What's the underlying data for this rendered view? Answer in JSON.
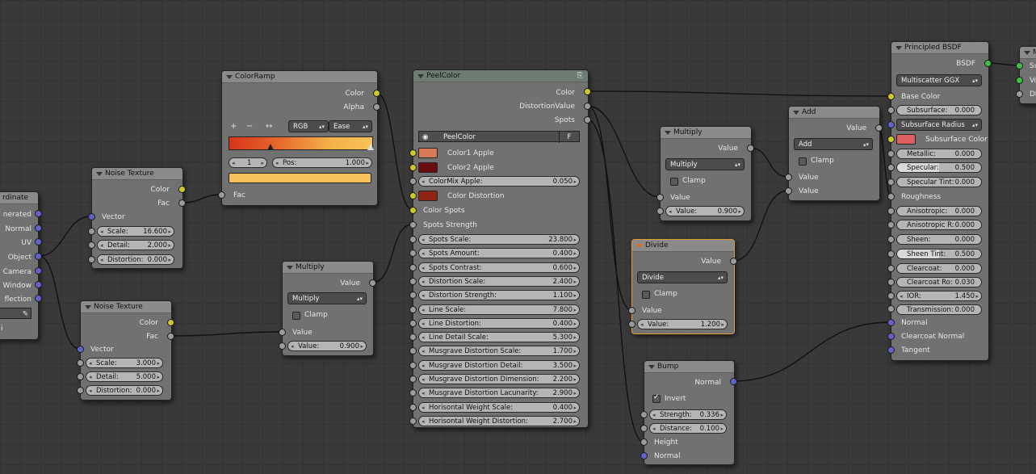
{
  "nodes": {
    "texcoord": {
      "title_partial": "rdinate",
      "outputs": [
        "nerated",
        "Normal",
        "UV",
        "Object",
        "Camera",
        "Window",
        "flection"
      ],
      "field_partial": "i"
    },
    "noise1": {
      "title": "Noise Texture",
      "outputs": [
        "Color",
        "Fac"
      ],
      "input_vector": "Vector",
      "fields": [
        {
          "label": "Scale:",
          "value": "16.600"
        },
        {
          "label": "Detail:",
          "value": "2.000"
        },
        {
          "label": "Distortion:",
          "value": "0.000"
        }
      ]
    },
    "noise2": {
      "title": "Noise Texture",
      "outputs": [
        "Color",
        "Fac"
      ],
      "input_vector": "Vector",
      "fields": [
        {
          "label": "Scale:",
          "value": "3.000"
        },
        {
          "label": "Detail:",
          "value": "5.000"
        },
        {
          "label": "Distortion:",
          "value": "0.000"
        }
      ]
    },
    "colorramp": {
      "title": "ColorRamp",
      "outputs": [
        "Color",
        "Alpha"
      ],
      "btn_plus": "+",
      "btn_minus": "−",
      "btn_flip": "↔",
      "mode": "RGB",
      "interp": "Ease",
      "index": "1",
      "pos_label": "Pos:",
      "pos_value": "1.000",
      "input": "Fac",
      "stop_color": "#f6c05a"
    },
    "multiply_left": {
      "title": "Multiply",
      "output": "Value",
      "op": "Multiply",
      "clamp": "Clamp",
      "input_value": "Value",
      "field": {
        "label": "Value:",
        "value": "0.900"
      }
    },
    "peelcolor": {
      "title": "PeelColor",
      "outputs": [
        "Color",
        "DistortionValue",
        "Spots"
      ],
      "group_name": "PeelColor",
      "group_f": "F",
      "color1_label": "Color1 Apple",
      "color1": "#d67a58",
      "color2_label": "Color2 Apple",
      "color2": "#6a0d10",
      "colormix": {
        "label": "ColorMix Apple:",
        "value": "0.050"
      },
      "color_dist_label": "Color Distortion",
      "color_dist": "#8e2517",
      "color_spots": "Color Spots",
      "spots_strength": "Spots Strength",
      "fields": [
        {
          "label": "Spots Scale:",
          "value": "23.800"
        },
        {
          "label": "Spots Amount:",
          "value": "0.400"
        },
        {
          "label": "Spots Contrast:",
          "value": "0.600"
        },
        {
          "label": "Distortion Scale:",
          "value": "2.400"
        },
        {
          "label": "Distortion Strength:",
          "value": "1.100"
        },
        {
          "label": "Line Scale:",
          "value": "7.800"
        },
        {
          "label": "Line Distortion:",
          "value": "0.400"
        },
        {
          "label": "Line Detail Scale:",
          "value": "5.300"
        },
        {
          "label": "Musgrave Distortion Scale:",
          "value": "1.700"
        },
        {
          "label": "Musgrave Distortion Detail:",
          "value": "3.500"
        },
        {
          "label": "Musgrave Distortion Dimension:",
          "value": "2.200"
        },
        {
          "label": "Musgrave Distortion Lacunarity:",
          "value": "2.900"
        },
        {
          "label": "Horisontal Weight Scale:",
          "value": "0.400"
        },
        {
          "label": "Horisontal Weight Distortion:",
          "value": "2.700"
        }
      ]
    },
    "multiply_right": {
      "title": "Multiply",
      "output": "Value",
      "op": "Multiply",
      "clamp": "Clamp",
      "input_value": "Value",
      "field": {
        "label": "Value:",
        "value": "0.900"
      }
    },
    "divide": {
      "title": "Divide",
      "output": "Value",
      "op": "Divide",
      "clamp": "Clamp",
      "input_value": "Value",
      "field": {
        "label": "Value:",
        "value": "1.200"
      }
    },
    "add": {
      "title": "Add",
      "output": "Value",
      "op": "Add",
      "clamp": "Clamp",
      "inputs": [
        "Value",
        "Value"
      ]
    },
    "bump": {
      "title": "Bump",
      "output": "Normal",
      "invert": "Invert",
      "fields": [
        {
          "label": "Strength:",
          "value": "0.336"
        },
        {
          "label": "Distance:",
          "value": "0.100"
        }
      ],
      "inputs": [
        "Height",
        "Normal"
      ]
    },
    "bsdf": {
      "title": "Principled BSDF",
      "output": "BSDF",
      "dist": "Multiscatter GGX",
      "base_color": "Base Color",
      "subsurface": {
        "label": "Subsurface:",
        "value": "0.000"
      },
      "ss_method": "Subsurface Radius",
      "ss_color_label": "Subsurface Color",
      "ss_color": "#e06060",
      "fields": [
        {
          "label": "Metallic:",
          "value": "0.000"
        },
        {
          "label": "Specular:",
          "value": "0.500"
        },
        {
          "label": "Specular Tint:",
          "value": "0.000"
        }
      ],
      "roughness": "Roughness",
      "fields2": [
        {
          "label": "Anisotropic:",
          "value": "0.000"
        },
        {
          "label": "Anisotropic R:",
          "value": "0.000"
        },
        {
          "label": "Sheen:",
          "value": "0.000"
        },
        {
          "label": "Sheen Tint:",
          "value": "0.500"
        },
        {
          "label": "Clearcoat:",
          "value": "0.000"
        },
        {
          "label": "Clearcoat Ro:",
          "value": "0.030"
        },
        {
          "label": "IOR:",
          "value": "1.450"
        },
        {
          "label": "Transmission:",
          "value": "0.000"
        }
      ],
      "inputs": [
        "Normal",
        "Clearcoat Normal",
        "Tangent"
      ]
    },
    "output": {
      "title_partial": "M",
      "inputs": [
        "Su",
        "Vo",
        "Di"
      ]
    }
  }
}
